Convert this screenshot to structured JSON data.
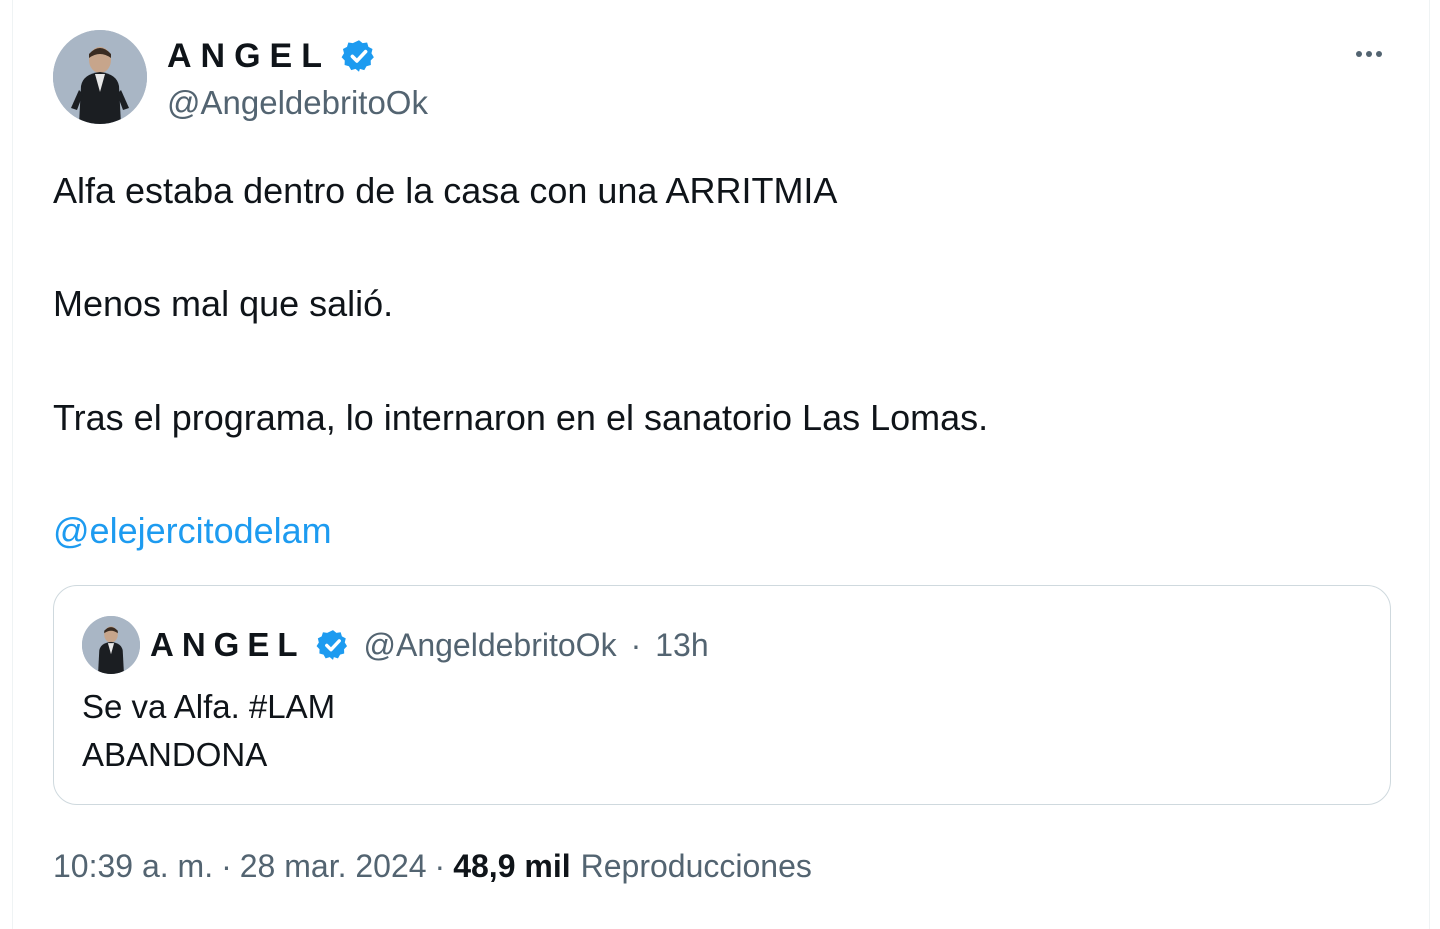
{
  "author": {
    "name": "ANGEL",
    "handle": "@AngeldebritoOk",
    "verified": true,
    "badge_color": "#1d9bf0"
  },
  "menu": {
    "icon": "more-horizontal-icon"
  },
  "tweet": {
    "lines": [
      "Alfa estaba dentro de la casa con una ARRITMIA",
      "Menos mal que salió.",
      "Tras el programa, lo internaron en el sanatorio Las Lomas."
    ],
    "mention": "@elejercitodelam",
    "mention_color": "#1d9bf0"
  },
  "quoted_tweet": {
    "name": "ANGEL",
    "handle": "@AngeldebritoOk",
    "dot": "·",
    "age": "13h",
    "lines": [
      "Se va Alfa. #LAM",
      "ABANDONA"
    ]
  },
  "footer": {
    "time": "10:39 a. m.",
    "dot1": "·",
    "date": "28 mar. 2024",
    "dot2": "·",
    "views_count": "48,9 mil",
    "views_label": "Reproducciones"
  }
}
